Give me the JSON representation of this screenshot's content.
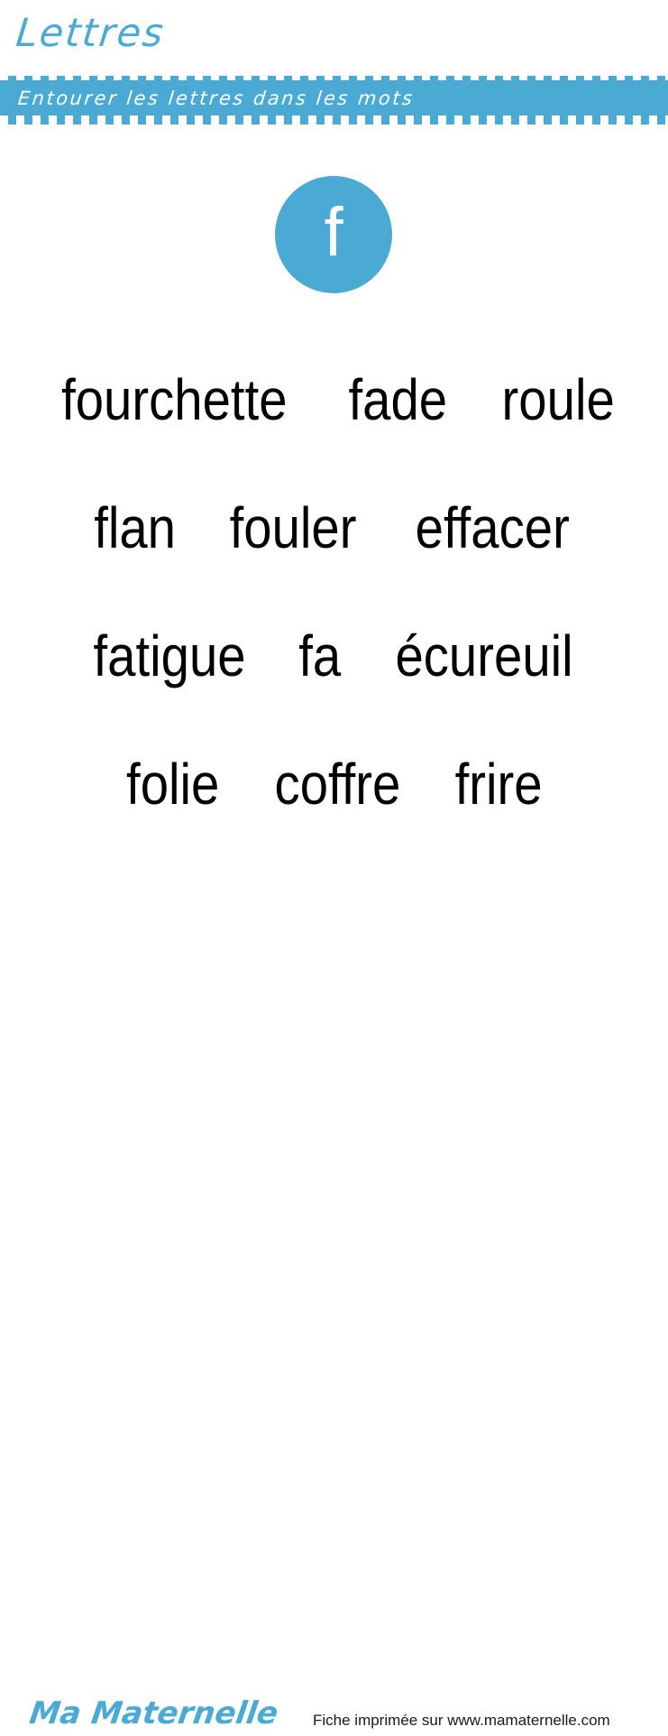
{
  "header": {
    "title": "Lettres",
    "instruction": "Entourer les lettres dans les mots"
  },
  "exercise": {
    "target_letter": "f",
    "rows": [
      {
        "words": [
          "fourchette",
          "fade",
          "roule"
        ]
      },
      {
        "words": [
          "flan",
          "fouler",
          "effacer"
        ]
      },
      {
        "words": [
          "fatigue",
          "fa",
          "écureuil"
        ]
      },
      {
        "words": [
          "folie",
          "coffre",
          "frire"
        ]
      }
    ]
  },
  "footer": {
    "logo": "Ma Maternelle",
    "note": "Fiche imprimée sur www.mamaternelle.com"
  },
  "colors": {
    "brand_blue": "#4aaad4",
    "text_black": "#000000",
    "background": "#ffffff"
  }
}
